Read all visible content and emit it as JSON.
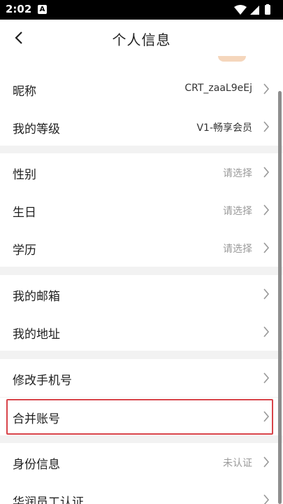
{
  "status": {
    "time": "2:02",
    "notif": "A"
  },
  "header": {
    "title": "个人信息"
  },
  "rows": [
    {
      "label": "昵称",
      "value": "CRT_zaaL9eEj",
      "muted": false
    },
    {
      "label": "我的等级",
      "value": "V1-畅享会员",
      "muted": false
    },
    {
      "label": "性别",
      "value": "请选择",
      "muted": true
    },
    {
      "label": "生日",
      "value": "请选择",
      "muted": true
    },
    {
      "label": "学历",
      "value": "请选择",
      "muted": true
    },
    {
      "label": "我的邮箱",
      "value": "",
      "muted": false
    },
    {
      "label": "我的地址",
      "value": "",
      "muted": false
    },
    {
      "label": "修改手机号",
      "value": "",
      "muted": false
    },
    {
      "label": "合并账号",
      "value": "",
      "muted": false
    },
    {
      "label": "身份信息",
      "value": "未认证",
      "muted": true
    },
    {
      "label": "华润员工认证",
      "value": "",
      "muted": false
    }
  ],
  "colors": {
    "highlight": "#d8444a",
    "background": "#f2f2f2"
  }
}
